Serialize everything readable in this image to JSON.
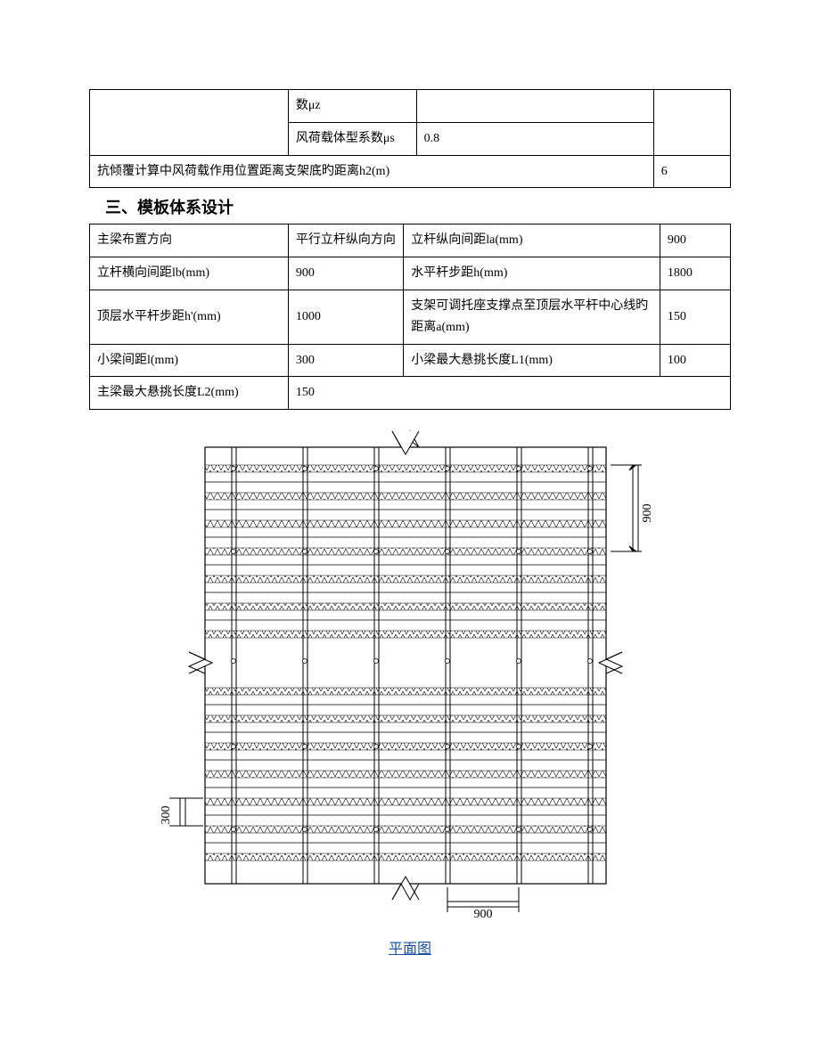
{
  "table1": {
    "r0c1": "数μz",
    "r0c2": "",
    "r1c1": "风荷载体型系数μs",
    "r1c2": "0.8",
    "r2c1": "抗倾覆计算中风荷载作用位置距离支架底旳距离h2(m)",
    "r2c2": "6"
  },
  "section_heading": "三、模板体系设计",
  "table2": {
    "r0c0": "主梁布置方向",
    "r0c1": "平行立杆纵向方向",
    "r0c2": "立杆纵向间距la(mm)",
    "r0c3": "900",
    "r1c0": "立杆横向间距lb(mm)",
    "r1c1": "900",
    "r1c2": "水平杆步距h(mm)",
    "r1c3": "1800",
    "r2c0": "顶层水平杆步距h'(mm)",
    "r2c1": "1000",
    "r2c2": "支架可调托座支撑点至顶层水平杆中心线旳距离a(mm)",
    "r2c3": "150",
    "r3c0": "小梁间距l(mm)",
    "r3c1": "300",
    "r3c2": "小梁最大悬挑长度L1(mm)",
    "r3c3": "100",
    "r4c0": "主梁最大悬挑长度L2(mm)",
    "r4c1": "150"
  },
  "diagram": {
    "dim_right": "900",
    "dim_left": "300",
    "dim_bottom": "900",
    "caption": "平面图"
  }
}
